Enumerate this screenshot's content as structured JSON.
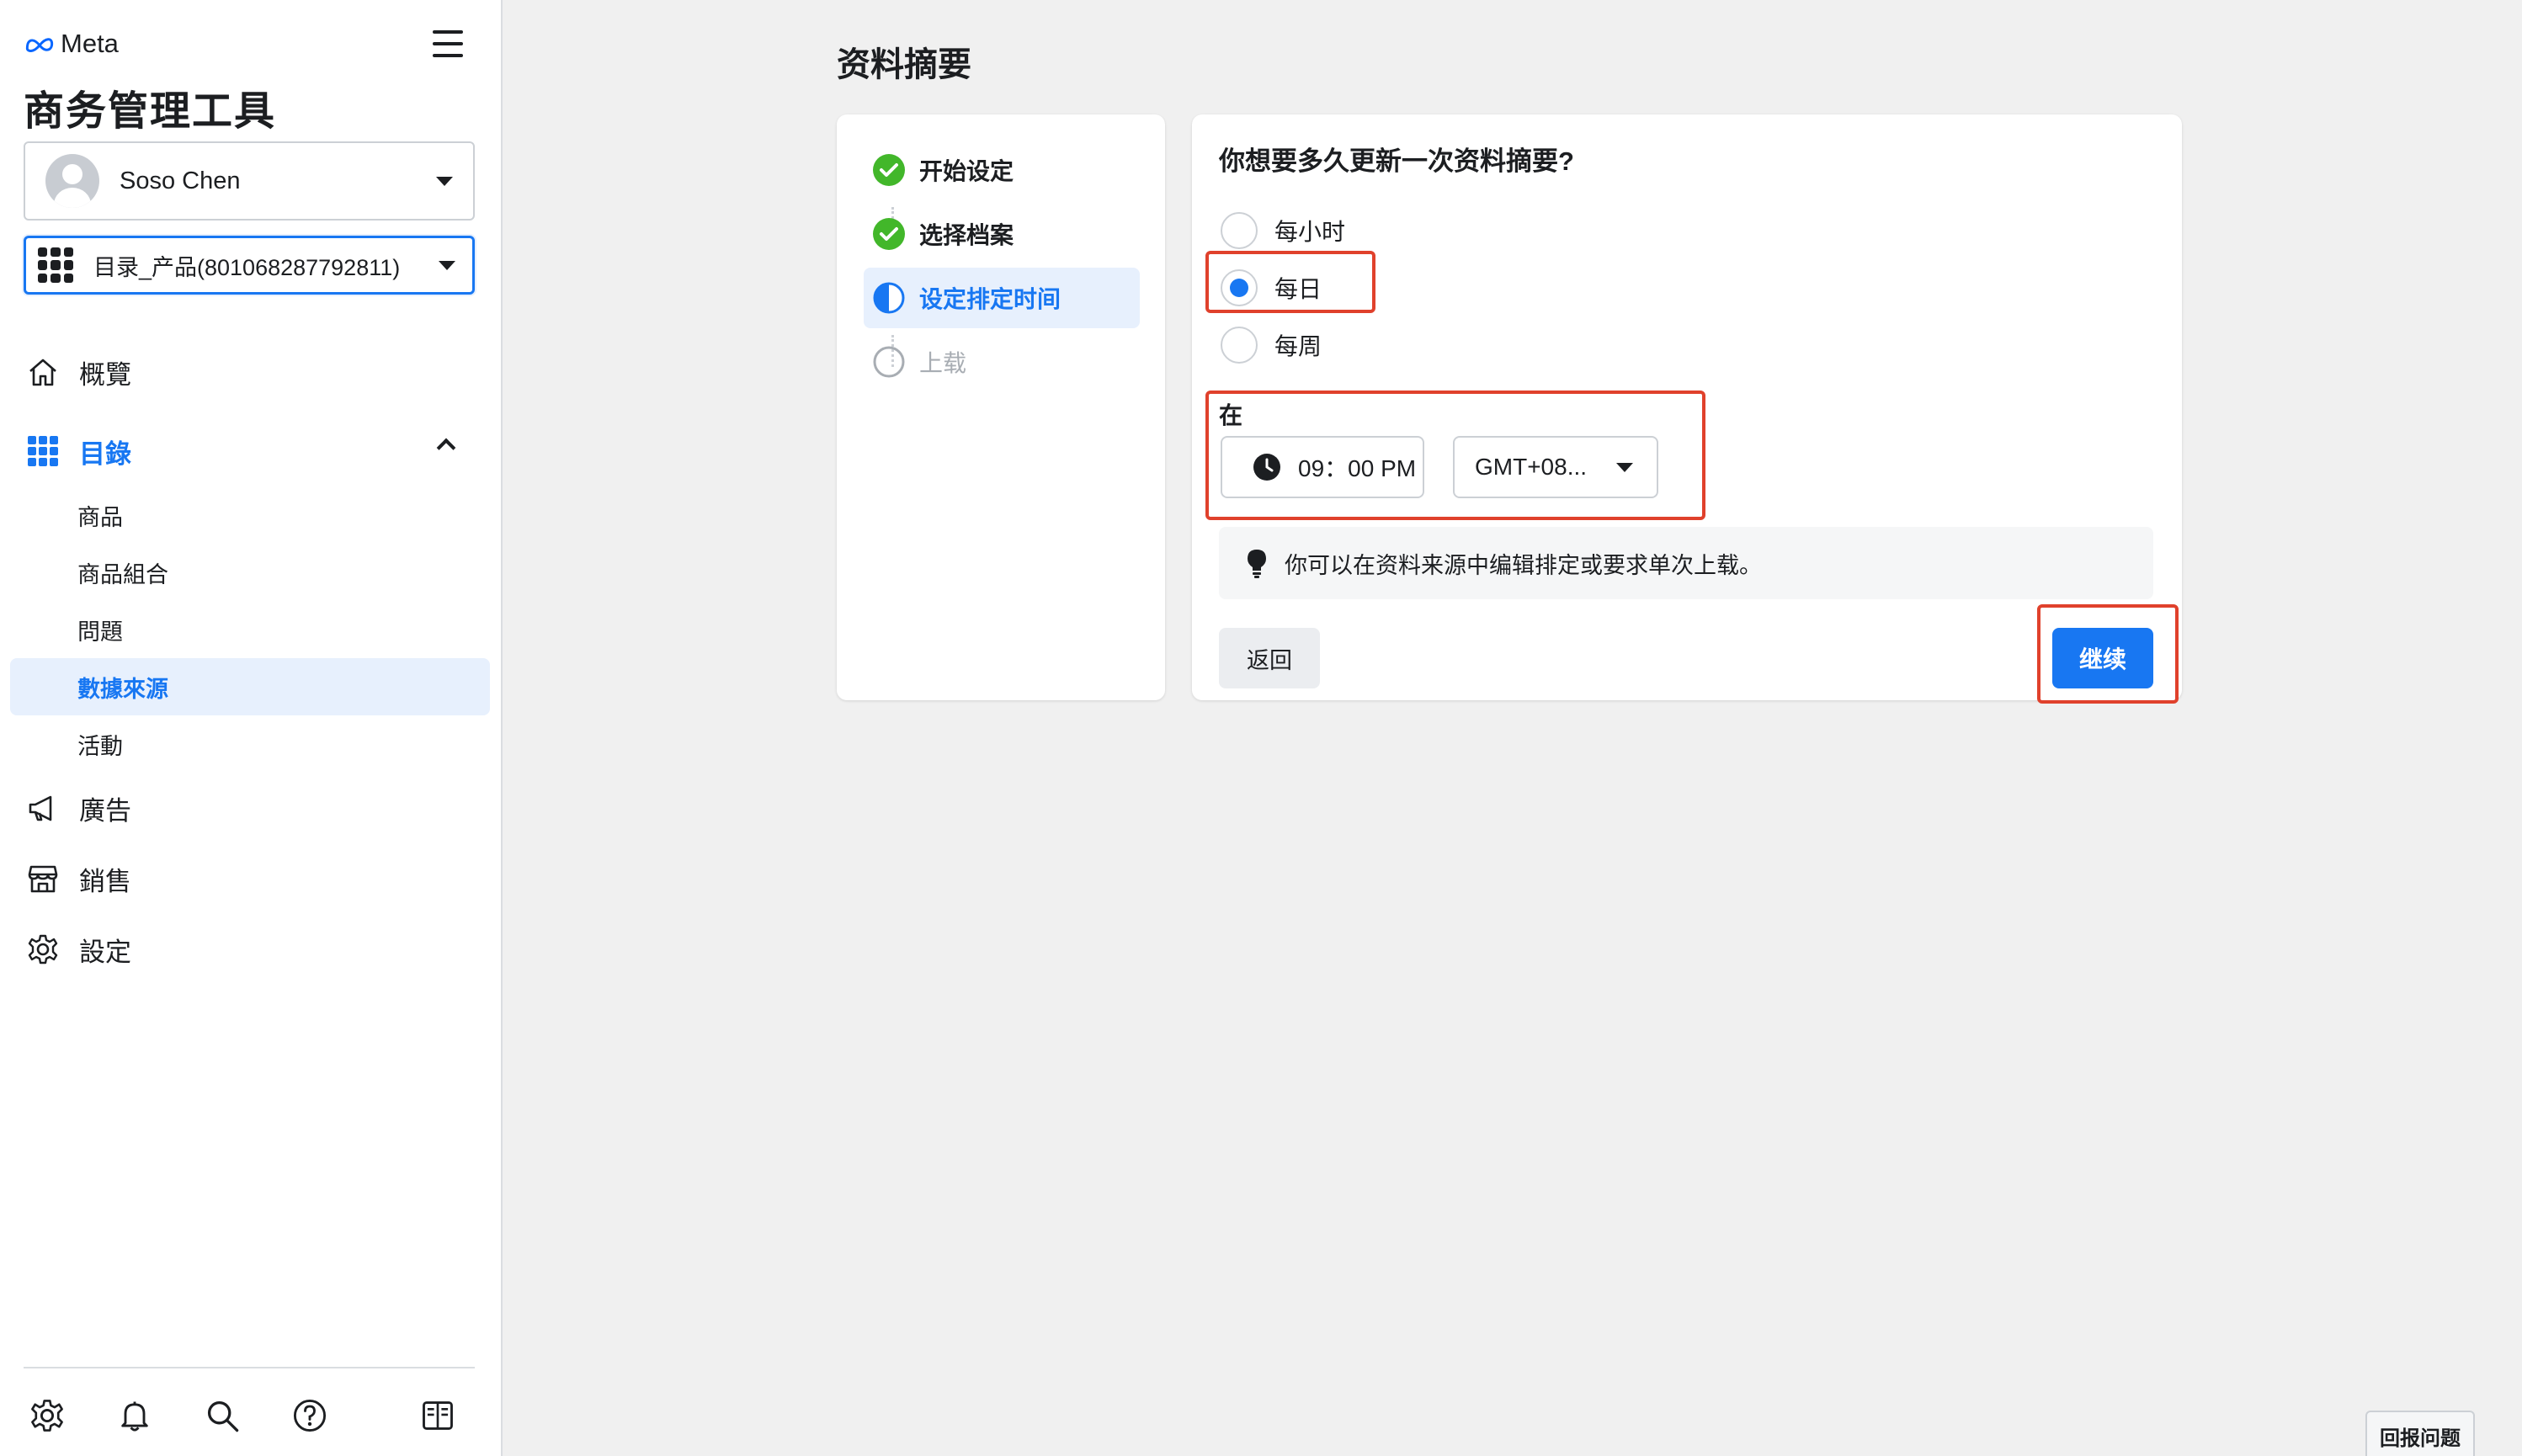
{
  "sidebar": {
    "brand": "Meta",
    "title": "商务管理工具",
    "user_name": "Soso Chen",
    "catalog": "目录_产品(801068287792811)",
    "nav": {
      "overview": "概覽",
      "catalog": "目錄",
      "products": "商品",
      "product_sets": "商品組合",
      "issues": "問題",
      "data_sources": "數據來源",
      "events": "活動",
      "ads": "廣告",
      "sales": "銷售",
      "settings": "設定"
    }
  },
  "main": {
    "heading": "资料摘要",
    "steps": [
      "开始设定",
      "选择档案",
      "设定排定时间",
      "上载"
    ],
    "question": "你想要多久更新一次资料摘要?",
    "options": [
      "每小时",
      "每日",
      "每周"
    ],
    "selected_option": "每日",
    "at_label": "在",
    "time_value": "09：00 PM",
    "timezone_value": "GMT+08...",
    "tip": "你可以在资料来源中编辑排定或要求单次上载。",
    "back_label": "返回",
    "continue_label": "继续"
  },
  "report_label": "回报问题",
  "colors": {
    "accent": "#1877f2",
    "success": "#42b72a",
    "highlight": "#e0412c"
  }
}
